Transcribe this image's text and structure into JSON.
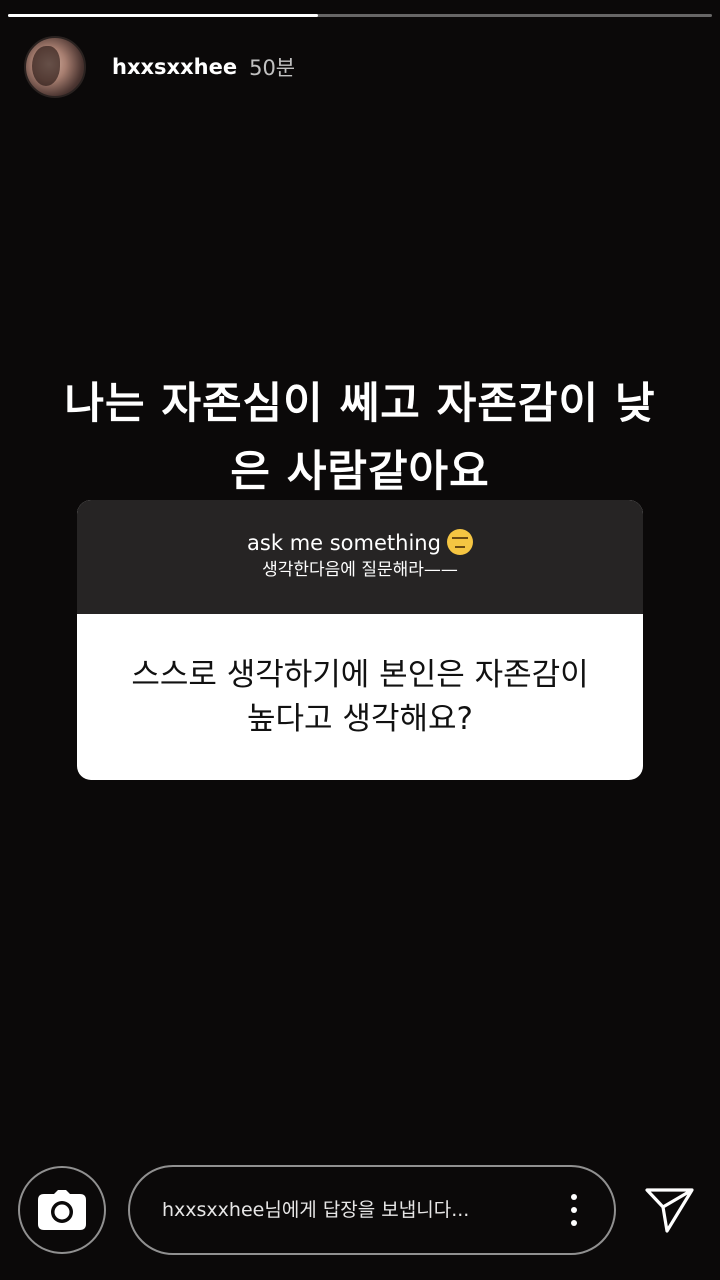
{
  "story": {
    "progress": 0.44,
    "username": "hxxsxxhee",
    "timestamp": "50분",
    "caption_line1": "나는 자존심이 쎄고 자존감이 낮",
    "caption_line2": "은 사람같아요"
  },
  "question_box": {
    "title": "ask me something",
    "emoji": "raised-eyebrow-emoji",
    "subtitle": "생각한다음에 질문해라——",
    "question_line1": "스스로 생각하기에 본인은 자존감이",
    "question_line2": "높다고 생각해요?"
  },
  "reply": {
    "placeholder": "hxxsxxhee님에게 답장을 보냅니다...",
    "camera_icon": "camera-icon",
    "more_icon": "more-vertical-icon",
    "send_icon": "send-icon"
  },
  "colors": {
    "background": "#0b0909",
    "question_header": "#262424",
    "question_body": "#ffffff"
  }
}
